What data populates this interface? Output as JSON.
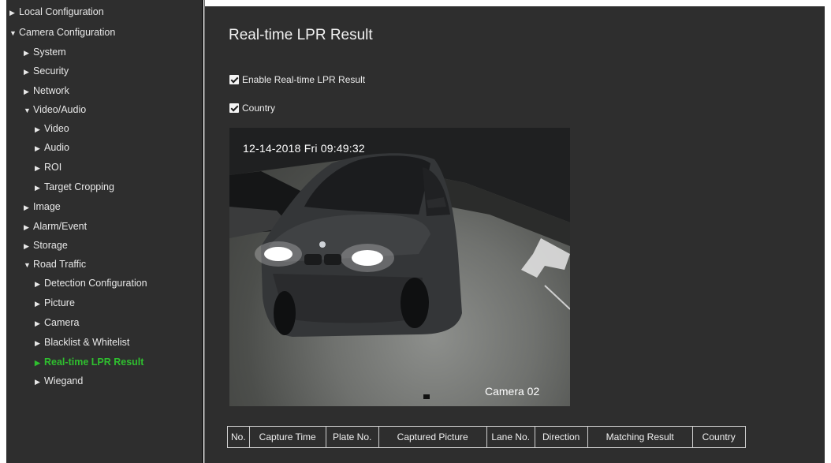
{
  "sidebar": {
    "items": [
      {
        "label": "Local Configuration",
        "expanded": false
      },
      {
        "label": "Camera Configuration",
        "expanded": true
      },
      {
        "label": "System",
        "expanded": false
      },
      {
        "label": "Security",
        "expanded": false
      },
      {
        "label": "Network",
        "expanded": false
      },
      {
        "label": "Video/Audio",
        "expanded": true
      },
      {
        "label": "Video",
        "expanded": false
      },
      {
        "label": "Audio",
        "expanded": false
      },
      {
        "label": "ROI",
        "expanded": false
      },
      {
        "label": "Target Cropping",
        "expanded": false
      },
      {
        "label": "Image",
        "expanded": false
      },
      {
        "label": "Alarm/Event",
        "expanded": false
      },
      {
        "label": "Storage",
        "expanded": false
      },
      {
        "label": "Road Traffic",
        "expanded": true
      },
      {
        "label": "Detection Configuration",
        "expanded": false
      },
      {
        "label": "Picture",
        "expanded": false
      },
      {
        "label": "Camera",
        "expanded": false
      },
      {
        "label": "Blacklist & Whitelist",
        "expanded": false
      },
      {
        "label": "Real-time LPR Result",
        "expanded": false,
        "active": true
      },
      {
        "label": "Wiegand",
        "expanded": false
      }
    ]
  },
  "main": {
    "title": "Real-time LPR Result",
    "enable_checkbox": {
      "label": "Enable Real-time LPR Result",
      "checked": true
    },
    "country_checkbox": {
      "label": "Country",
      "checked": true
    },
    "video": {
      "timestamp": "12-14-2018  Fri  09:49:32",
      "camera_name": "Camera 02"
    },
    "table": {
      "columns": [
        "No.",
        "Capture Time",
        "Plate No.",
        "Captured Picture",
        "Lane No.",
        "Direction",
        "Matching Result",
        "Country"
      ]
    }
  },
  "colors": {
    "panel_bg": "#2e2e2e",
    "text": "#e8e8e8",
    "active_item": "#2fbf2f",
    "page_bg": "#ffffff"
  },
  "icons": {
    "collapsed_arrow": "triangle-right-icon",
    "expanded_arrow": "triangle-down-icon",
    "checkbox": "checkmark-icon"
  }
}
